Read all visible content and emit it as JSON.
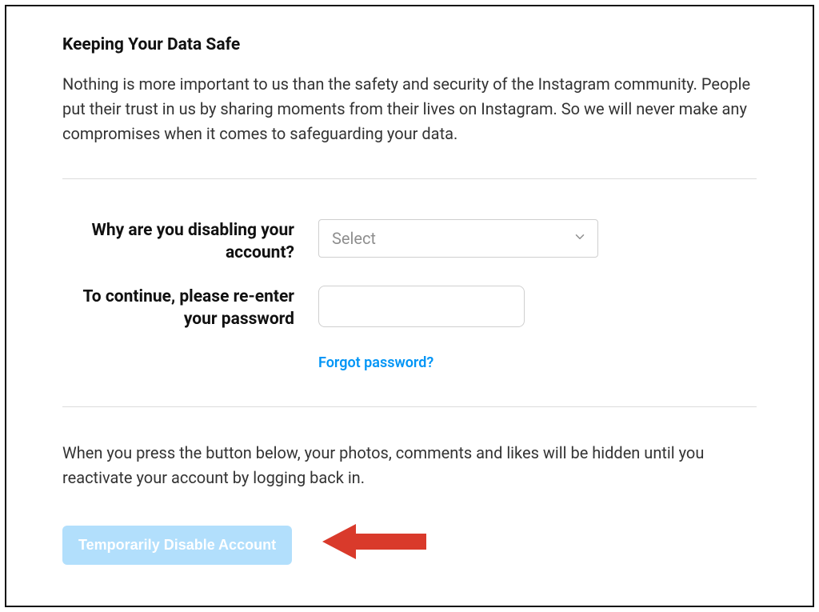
{
  "header": {
    "title": "Keeping Your Data Safe",
    "body": "Nothing is more important to us than the safety and security of the Instagram community. People put their trust in us by sharing moments from their lives on Instagram. So we will never make any compromises when it comes to safeguarding your data."
  },
  "form": {
    "reason_label": "Why are you disabling your account?",
    "reason_placeholder": "Select",
    "password_label": "To continue, please re-enter your password",
    "password_value": "",
    "forgot_link": "Forgot password?"
  },
  "footer": {
    "note": "When you press the button below, your photos, comments and likes will be hidden until you reactivate your account by logging back in.",
    "button_label": "Temporarily Disable Account"
  },
  "colors": {
    "link": "#0095f6",
    "button_bg": "#b2dffc",
    "annotation": "#d93a2b"
  }
}
